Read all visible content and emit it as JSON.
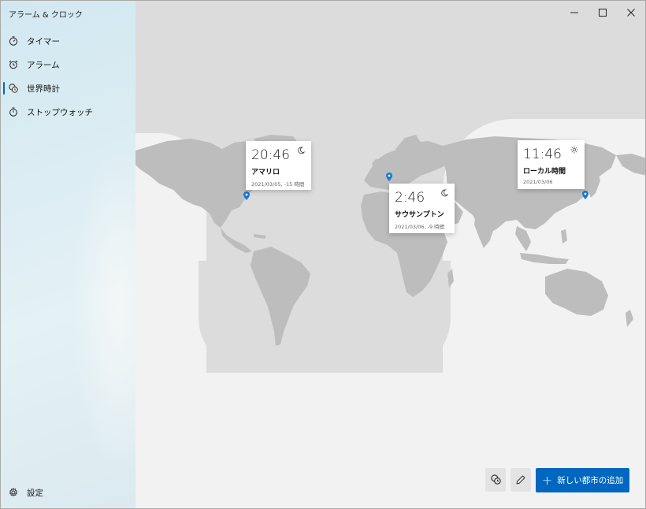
{
  "app": {
    "title": "アラーム & クロック"
  },
  "sidebar": {
    "items": [
      {
        "label": "タイマー",
        "icon": "timer-icon",
        "active": false
      },
      {
        "label": "アラーム",
        "icon": "alarm-clock-icon",
        "active": false
      },
      {
        "label": "世界時計",
        "icon": "world-clock-icon",
        "active": true
      },
      {
        "label": "ストップウォッチ",
        "icon": "stopwatch-icon",
        "active": false
      }
    ],
    "settings_label": "設定"
  },
  "window_controls": [
    "minimize",
    "maximize",
    "close"
  ],
  "cities": [
    {
      "time": "20:46",
      "name": "アマリロ",
      "date": "2021/03/05, -15 時間",
      "state": "night"
    },
    {
      "time": "2:46",
      "name": "サウサンプトン",
      "date": "2021/03/06, -9 時間",
      "state": "night"
    },
    {
      "time": "11:46",
      "name": "ローカル時間",
      "date": "2021/03/06",
      "state": "day"
    }
  ],
  "toolbar": {
    "compare_icon": "compare-clocks-icon",
    "edit_icon": "edit-icon",
    "add_label": "新しい都市の追加"
  },
  "colors": {
    "accent": "#0067c0",
    "land": "#bdbdbd",
    "pin": "#1479d0"
  }
}
